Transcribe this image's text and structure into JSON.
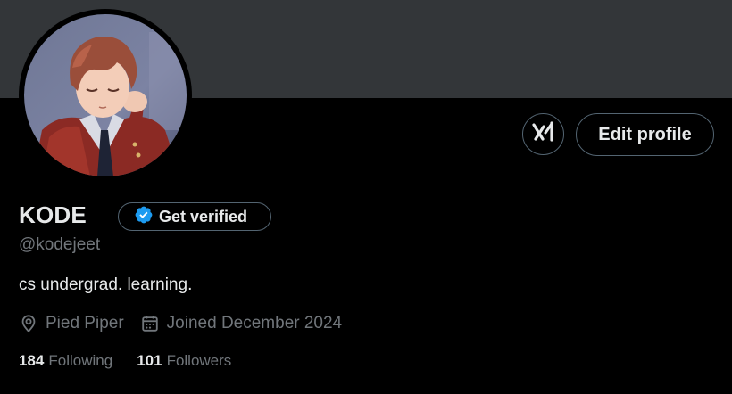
{
  "profile": {
    "display_name": "KODE",
    "handle": "@kodejeet",
    "bio": "cs undergrad. learning.",
    "location": "Pied Piper",
    "joined": "Joined December 2024"
  },
  "actions": {
    "verify_label": "Get verified",
    "edit_profile_label": "Edit profile",
    "grok_icon": "grok-icon"
  },
  "stats": {
    "following_count": "184",
    "following_label": "Following",
    "followers_count": "101",
    "followers_label": "Followers"
  },
  "colors": {
    "background": "#000000",
    "banner": "#333639",
    "primary_text": "#e7e9ea",
    "secondary_text": "#71767b",
    "border": "#536471",
    "verified_badge": "#1d9bf0"
  }
}
